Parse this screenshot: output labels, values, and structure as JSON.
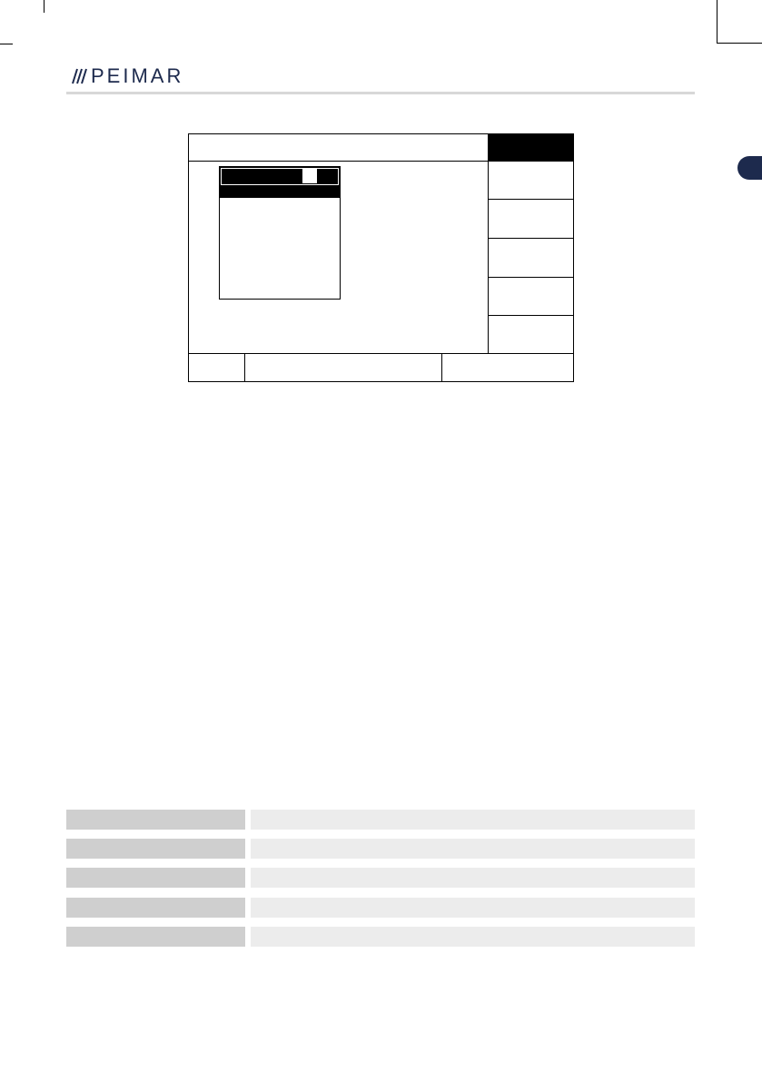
{
  "header": {
    "brand": "PEIMAR",
    "brand_color": "#1d2a4d",
    "logo_icon": "triple-slash-logo-icon"
  },
  "screen": {
    "title": "",
    "softkeys": [
      "",
      "",
      "",
      "",
      ""
    ],
    "status": [
      "",
      "",
      ""
    ]
  },
  "parameter_table": {
    "rows": [
      {
        "key": "",
        "value": ""
      },
      {
        "key": "",
        "value": ""
      },
      {
        "key": "",
        "value": ""
      },
      {
        "key": "",
        "value": ""
      },
      {
        "key": "",
        "value": ""
      }
    ]
  },
  "colors": {
    "key_cell": "#cfcfcf",
    "value_cell": "#ececec",
    "rule": "#d8d8d8"
  }
}
